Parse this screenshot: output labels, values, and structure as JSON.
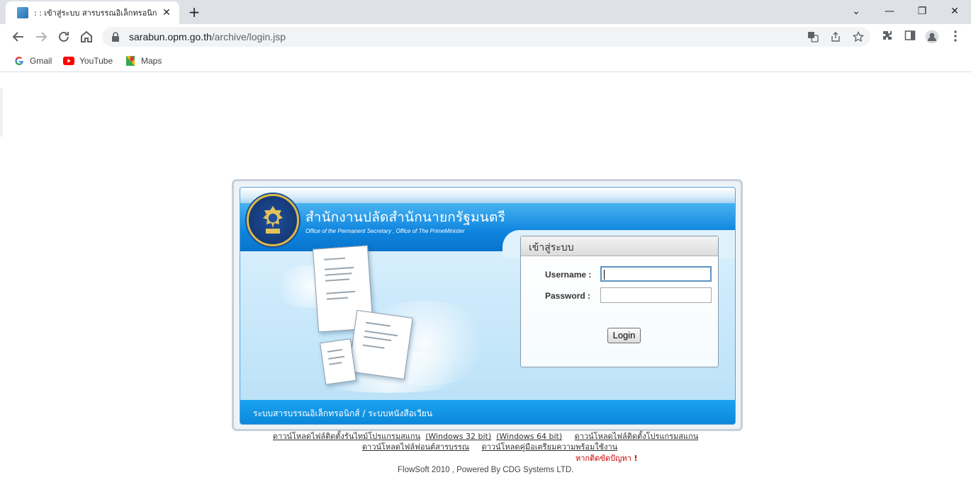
{
  "browser": {
    "tab_title": ": : เข้าสู่ระบบ สารบรรณอิเล็กทรอนิกส์ :",
    "tab_close": "✕",
    "new_tab": "+",
    "url_host": "sarabun.opm.go.th",
    "url_path": "/archive/login.jsp",
    "window_controls": {
      "dropdown": "⌄",
      "minimize": "—",
      "restore": "❐",
      "close": "✕"
    },
    "bookmarks": [
      {
        "label": "Gmail",
        "icon": "google-icon"
      },
      {
        "label": "YouTube",
        "icon": "youtube-icon"
      },
      {
        "label": "Maps",
        "icon": "maps-icon"
      }
    ]
  },
  "banner": {
    "org_name_th": "สำนักงานปลัดสำนักนายกรัฐมนตรี",
    "org_name_en": "Office of the Permanent Secretary , Office of The PrimeMinister",
    "footer_text": "ระบบสารบรรณอิเล็กทรอนิกส์ / ระบบหนังสือเวียน"
  },
  "login": {
    "title": "เข้าสู่ระบบ",
    "username_label": "Username :",
    "password_label": "Password :",
    "username_value": "",
    "password_value": "",
    "button_label": "Login"
  },
  "links": {
    "download_runtime": "ดาวน์โหลดไฟล์ติดตั้งรันไทม์โปรแกรมสแกน",
    "win32": "(Windows 32 bit)",
    "win64": "(Windows 64 bit)",
    "download_scanner": "ดาวน์โหลดไฟล์ติดตั้งโปรแกรมสแกน",
    "download_font": "ดาวน์โหลดไฟล์ฟอนต์สารบรรณ",
    "download_manual": "ดาวน์โหลดคู่มือเตรียมความพร้อมใช้งาน",
    "trouble": "หากติดขัดปัญหา",
    "trouble_mark": "!",
    "powered_by": "FlowSoft 2010 , Powered By CDG Systems LTD."
  },
  "colors": {
    "banner_blue": "#0a86da",
    "error_red": "#cc0000",
    "emblem_gold": "#d9b84a"
  }
}
